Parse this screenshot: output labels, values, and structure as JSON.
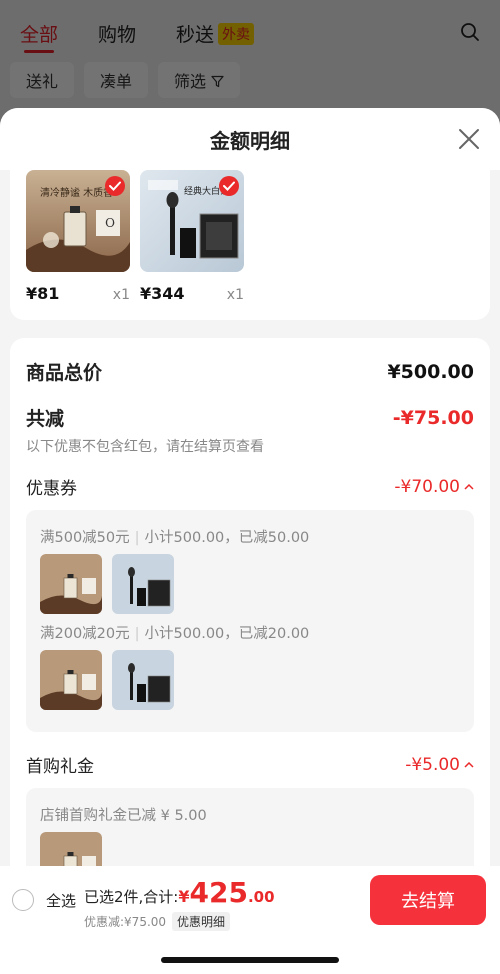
{
  "background_app": {
    "tabs": [
      "全部",
      "购物",
      "秒送"
    ],
    "waimai_tag": "外卖",
    "chips": [
      "送礼",
      "凑单",
      "筛选"
    ]
  },
  "sheet": {
    "title": "金额明细"
  },
  "products": [
    {
      "price": "¥81",
      "qty": "x1",
      "image": "perfume",
      "checked": true,
      "image_text": "清冷静谧 木质香"
    },
    {
      "price": "¥344",
      "qty": "x1",
      "image": "makeup-set",
      "checked": true,
      "image_text": "经典大白饼"
    }
  ],
  "detail": {
    "goods_total_label": "商品总价",
    "goods_total_value": "¥500.00",
    "reduce_label": "共减",
    "reduce_value": "-¥75.00",
    "reduce_note": "以下优惠不包含红包，请在结算页查看",
    "coupon_label": "优惠券",
    "coupon_value": "-¥70.00",
    "coupon_rules": [
      {
        "rule": "满500减50元",
        "detail": "小计500.00，已减50.00"
      },
      {
        "rule": "满200减20元",
        "detail": "小计500.00，已减20.00"
      }
    ],
    "first_gift_label": "首购礼金",
    "first_gift_value": "-¥5.00",
    "first_gift_note": "店铺首购礼金已减 ¥ 5.00"
  },
  "bottom_bar": {
    "select_all": "全选",
    "summary": "已选2件,合计:",
    "total_symbol": "¥",
    "total_int": "425",
    "total_dec": ".00",
    "discount_text": "优惠减:¥75.00",
    "detail_tag": "优惠明细",
    "checkout_label": "去结算"
  },
  "colors": {
    "accent_red": "#ea2a2a",
    "checkout_red": "#f5313b"
  }
}
